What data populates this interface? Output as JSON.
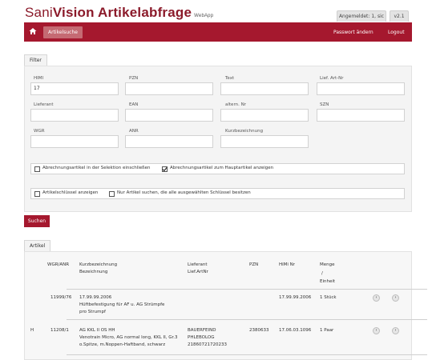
{
  "brand": {
    "name_part1": "Sani",
    "name_part2": "Vision",
    "name_part3": " Artikelabfrage",
    "subtitle": "WebApp"
  },
  "header": {
    "logged_in": "Angemeldet: 1, sic",
    "version": "v2.1"
  },
  "nav": {
    "home_icon": "home-icon",
    "tab": "Artikelsuche",
    "password": "Passwort ändern",
    "logout": "Logout"
  },
  "filter": {
    "tab": "Filter",
    "fields": {
      "himi": {
        "label": "HIMI",
        "value": "17"
      },
      "pzn": {
        "label": "PZN",
        "value": ""
      },
      "text": {
        "label": "Text",
        "value": ""
      },
      "lief_art_nr": {
        "label": "Lief. Art-Nr",
        "value": ""
      },
      "lieferant": {
        "label": "Lieferant",
        "value": ""
      },
      "ean": {
        "label": "EAN",
        "value": ""
      },
      "altern_nr": {
        "label": "altern. Nr",
        "value": ""
      },
      "szn": {
        "label": "SZN",
        "value": ""
      },
      "wgr": {
        "label": "WGR",
        "value": ""
      },
      "anr": {
        "label": "ANR",
        "value": ""
      },
      "kurzbezeichnung": {
        "label": "Kurzbezeichnung",
        "value": ""
      }
    },
    "checkboxes": {
      "abrechnung_selektion": {
        "label": "Abrechnungsartikel in der Selektion einschließen",
        "checked": false
      },
      "abrechnung_hauptartikel": {
        "label": "Abrechnungsartikel zum Hauptartikel anzeigen",
        "checked": true
      },
      "schluessel_anzeigen": {
        "label": "Artikelschlüssel anzeigen",
        "checked": false
      },
      "nur_artikel": {
        "label": "Nur Artikel suchen, die alle ausgewählten Schlüssel besitzen",
        "checked": false
      }
    },
    "search_button": "Suchen"
  },
  "artikel": {
    "tab": "Artikel",
    "headers": {
      "wgr_anr": "WGR/ANR",
      "kurzbez": "Kurzbezeichnung",
      "bezeichnung": "Bezeichnung",
      "lieferant": "Lieferant",
      "lief_artnr": "Lief.ArtNr",
      "pzn": "PZN",
      "himi": "HiMi Nr",
      "menge": "Menge",
      "slash": "/",
      "einheit": "Einheit"
    },
    "rows": [
      {
        "flag": "",
        "wgr_anr": "11999/76",
        "kurz": "17.99.99.2006",
        "bez_lines": [
          "Hüftbefestigung für AF u. AG Strümpfe",
          "pro Strumpf"
        ],
        "lieferant_lines": [
          "",
          "",
          ""
        ],
        "pzn": "",
        "himi": "17.99.99.2006",
        "menge": "1 Stück"
      },
      {
        "flag": "H",
        "wgr_anr": "11208/1",
        "kurz": "AG KKL II OS HH",
        "bez_lines": [
          "Venotrain Micro, AG normal long, KKL II, Gr.3",
          "o.Spitze, m.Noppen-Haftband, schwarz"
        ],
        "lieferant_lines": [
          "BAUERFEIND",
          "PHLEBOLOG",
          "21860721720233"
        ],
        "pzn": "2380633",
        "himi": "17.06.03.1096",
        "menge": "1 Paar"
      }
    ]
  }
}
